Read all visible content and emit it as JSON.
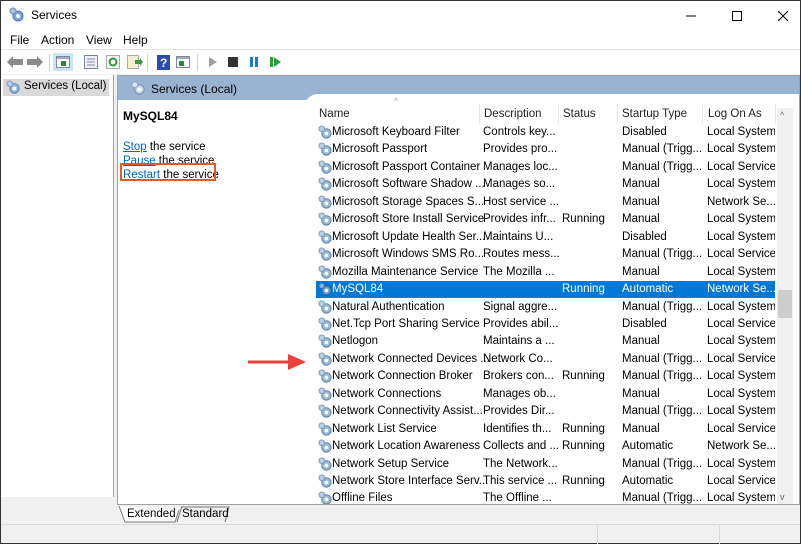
{
  "window": {
    "title": "Services",
    "minimize": "—",
    "maximize": "☐",
    "close": "✕"
  },
  "menu": [
    "File",
    "Action",
    "View",
    "Help"
  ],
  "toolbar": {
    "buttons": [
      "back-icon",
      "forward-icon",
      "show-hide-console-tree-icon",
      "properties-icon",
      "refresh-icon",
      "export-list-icon",
      "help-icon",
      "show-action-pane-icon",
      "start-service-icon",
      "stop-service-icon",
      "pause-service-icon",
      "resume-service-icon"
    ]
  },
  "tree": {
    "root": "Services (Local)"
  },
  "main": {
    "header": "Services (Local)",
    "selected_service": "MySQL84",
    "actions": [
      {
        "link": "Stop",
        "rest": " the service"
      },
      {
        "link": "Pause",
        "rest": " the service"
      },
      {
        "link": "Restart",
        "rest": " the service"
      }
    ],
    "highlight_color": "#e05a2b",
    "arrow_color": "#e8413a"
  },
  "list": {
    "columns": [
      "Name",
      "Description",
      "Status",
      "Startup Type",
      "Log On As"
    ],
    "rows": [
      [
        "Microsoft Keyboard Filter",
        "Controls key...",
        "",
        "Disabled",
        "Local System"
      ],
      [
        "Microsoft Passport",
        "Provides pro...",
        "",
        "Manual (Trigg...",
        "Local System"
      ],
      [
        "Microsoft Passport Container",
        "Manages loc...",
        "",
        "Manual (Trigg...",
        "Local Service"
      ],
      [
        "Microsoft Software Shadow ...",
        "Manages so...",
        "",
        "Manual",
        "Local System"
      ],
      [
        "Microsoft Storage Spaces S...",
        "Host service ...",
        "",
        "Manual",
        "Network Se..."
      ],
      [
        "Microsoft Store Install Service",
        "Provides infr...",
        "Running",
        "Manual",
        "Local System"
      ],
      [
        "Microsoft Update Health Ser...",
        "Maintains U...",
        "",
        "Disabled",
        "Local System"
      ],
      [
        "Microsoft Windows SMS Ro...",
        "Routes mess...",
        "",
        "Manual (Trigg...",
        "Local Service"
      ],
      [
        "Mozilla Maintenance Service",
        "The Mozilla ...",
        "",
        "Manual",
        "Local System"
      ],
      [
        "MySQL84",
        "",
        "Running",
        "Automatic",
        "Network Se..."
      ],
      [
        "Natural Authentication",
        "Signal aggre...",
        "",
        "Manual (Trigg...",
        "Local System"
      ],
      [
        "Net.Tcp Port Sharing Service",
        "Provides abil...",
        "",
        "Disabled",
        "Local Service"
      ],
      [
        "Netlogon",
        "Maintains a ...",
        "",
        "Manual",
        "Local System"
      ],
      [
        "Network Connected Devices ...",
        "Network Co...",
        "",
        "Manual (Trigg...",
        "Local Service"
      ],
      [
        "Network Connection Broker",
        "Brokers con...",
        "Running",
        "Manual (Trigg...",
        "Local System"
      ],
      [
        "Network Connections",
        "Manages ob...",
        "",
        "Manual",
        "Local System"
      ],
      [
        "Network Connectivity Assist...",
        "Provides Dir...",
        "",
        "Manual (Trigg...",
        "Local System"
      ],
      [
        "Network List Service",
        "Identifies th...",
        "Running",
        "Manual",
        "Local Service"
      ],
      [
        "Network Location Awareness",
        "Collects and ...",
        "Running",
        "Automatic",
        "Network Se..."
      ],
      [
        "Network Setup Service",
        "The Network...",
        "",
        "Manual (Trigg...",
        "Local System"
      ],
      [
        "Network Store Interface Serv...",
        "This service ...",
        "Running",
        "Automatic",
        "Local Service"
      ],
      [
        "Offline Files",
        "The Offline ...",
        "",
        "Manual (Trigg...",
        "Local System"
      ]
    ],
    "selected_index": 9
  },
  "tabs": [
    "Extended",
    "Standard"
  ]
}
